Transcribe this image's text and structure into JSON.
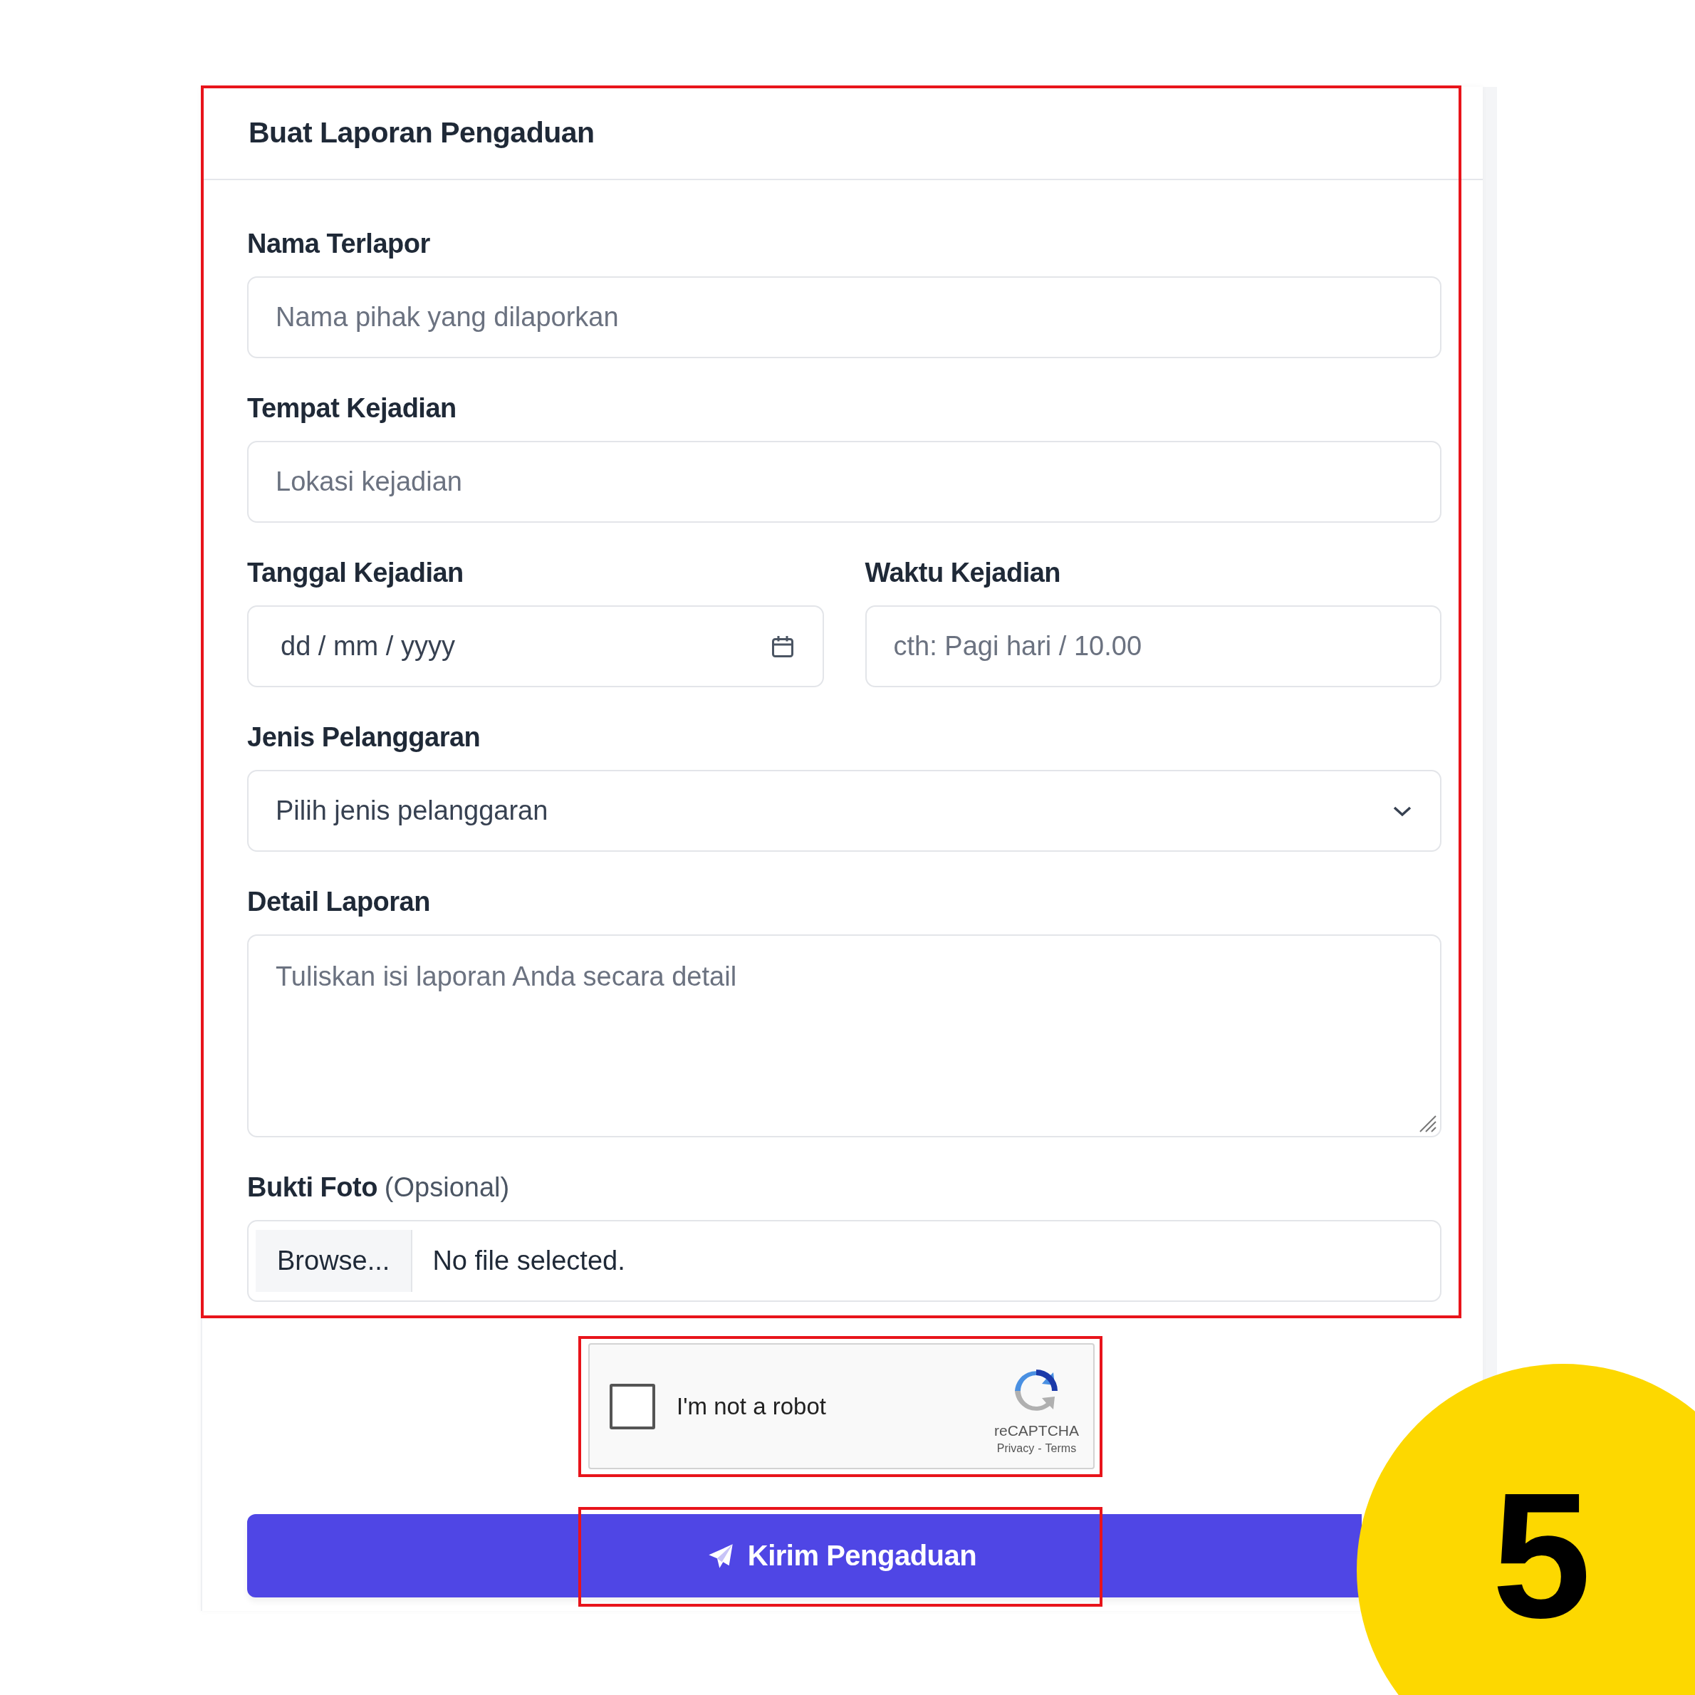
{
  "form": {
    "title": "Buat Laporan Pengaduan",
    "fields": [
      {
        "kind": "text",
        "label": "Nama Terlapor",
        "placeholder": "Nama pihak yang dilaporkan"
      },
      {
        "kind": "text",
        "label": "Tempat Kejadian",
        "placeholder": "Lokasi kejadian"
      },
      {
        "kind": "date",
        "label": "Tanggal Kejadian",
        "value": "dd / mm / yyyy"
      },
      {
        "kind": "time",
        "label": "Waktu Kejadian",
        "placeholder": "cth: Pagi hari / 10.00"
      },
      {
        "kind": "select",
        "label": "Jenis Pelanggaran",
        "value": "Pilih jenis pelanggaran"
      },
      {
        "kind": "textarea",
        "label": "Detail Laporan",
        "placeholder": "Tuliskan isi laporan Anda secara detail"
      },
      {
        "kind": "file",
        "label": "Bukti Foto",
        "note": "(Opsional)",
        "button": "Browse...",
        "status": "No file selected."
      }
    ],
    "captcha": {
      "label": "I'm not a robot",
      "checked": false,
      "brand": "reCAPTCHA",
      "links": [
        "Privacy",
        "Terms"
      ],
      "separator": "-"
    },
    "submit": "Kirim Pengaduan"
  },
  "annotation": {
    "step": "5"
  }
}
